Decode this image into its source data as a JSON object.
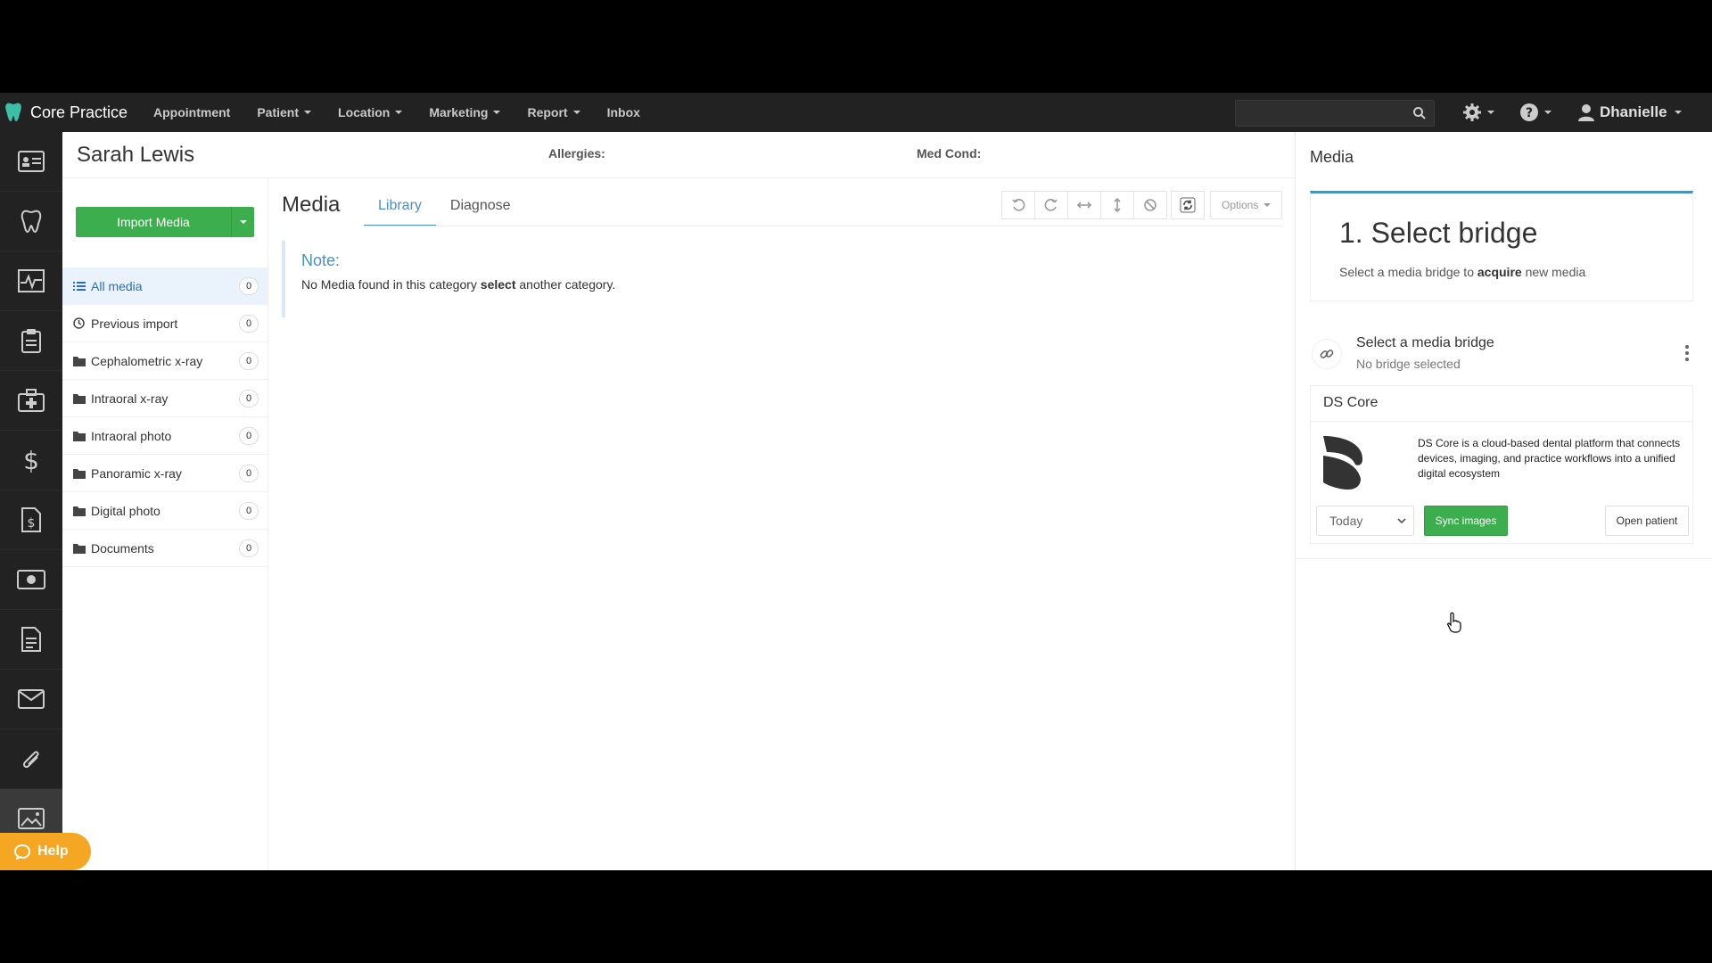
{
  "app": {
    "brand": "Core Practice"
  },
  "nav": {
    "items": [
      {
        "label": "Appointment",
        "dropdown": false
      },
      {
        "label": "Patient",
        "dropdown": true
      },
      {
        "label": "Location",
        "dropdown": true
      },
      {
        "label": "Marketing",
        "dropdown": true
      },
      {
        "label": "Report",
        "dropdown": true
      },
      {
        "label": "Inbox",
        "dropdown": false
      }
    ],
    "user": "Dhanielle"
  },
  "rail": {
    "icons": [
      "patient-card-icon",
      "tooth-icon",
      "chart-pulse-icon",
      "clipboard-icon",
      "medkit-icon",
      "dollar-icon",
      "invoice-icon",
      "payment-icon",
      "document-icon",
      "mail-icon",
      "paperclip-icon",
      "media-image-icon"
    ],
    "active": "media-image-icon",
    "help_label": "Help"
  },
  "patient": {
    "name": "Sarah Lewis",
    "allergies_label": "Allergies:",
    "medcond_label": "Med Cond:"
  },
  "categories": {
    "import_label": "Import Media",
    "items": [
      {
        "label": "All media",
        "count": "0",
        "icon": "list-icon"
      },
      {
        "label": "Previous import",
        "count": "0",
        "icon": "clock-icon"
      },
      {
        "label": "Cephalometric x-ray",
        "count": "0",
        "icon": "folder-icon"
      },
      {
        "label": "Intraoral x-ray",
        "count": "0",
        "icon": "folder-icon"
      },
      {
        "label": "Intraoral photo",
        "count": "0",
        "icon": "folder-icon"
      },
      {
        "label": "Panoramic x-ray",
        "count": "0",
        "icon": "folder-icon"
      },
      {
        "label": "Digital photo",
        "count": "0",
        "icon": "folder-icon"
      },
      {
        "label": "Documents",
        "count": "0",
        "icon": "folder-icon"
      }
    ]
  },
  "media": {
    "title": "Media",
    "tabs": [
      {
        "label": "Library"
      },
      {
        "label": "Diagnose"
      }
    ],
    "active_tab": "Library",
    "options_label": "Options",
    "note": {
      "title": "Note:",
      "text_before": "No Media found in this category ",
      "text_bold": "select",
      "text_after": " another category."
    }
  },
  "sidebar": {
    "title": "Media",
    "step_heading": "1. Select bridge",
    "step_sub_before": "Select a media bridge to ",
    "step_sub_bold": "acquire",
    "step_sub_after": " new media",
    "bridge_title": "Select a media bridge",
    "bridge_sub": "No bridge selected",
    "ds": {
      "name": "DS Core",
      "description": "DS Core is a cloud-based dental platform that connects devices, imaging, and practice workflows into a unified digital ecosystem",
      "range_value": "Today",
      "sync_label": "Sync images",
      "open_label": "Open patient"
    }
  },
  "colors": {
    "nav_bg": "#222222",
    "accent_green": "#3cae4d",
    "link_blue": "#4a90c2",
    "help_orange": "#f5a623"
  }
}
